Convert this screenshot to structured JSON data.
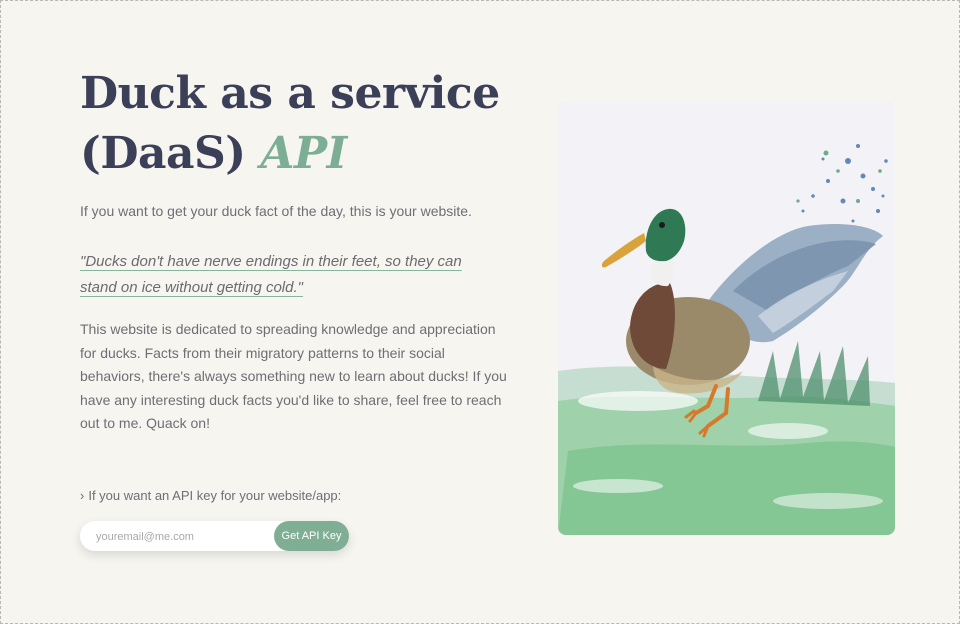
{
  "hero": {
    "title_line1": "Duck as a service",
    "title_line2": "(DaaS)",
    "title_accent": "API",
    "intro": "If you want to get your duck fact of the day, this is your website.",
    "quote": "\"Ducks don't have nerve endings in their feet, so they can stand on ice without getting cold.\"",
    "body": "This website is dedicated to spreading knowledge and appreciation for ducks. Facts from their migratory patterns to their social behaviors, there's always something new to learn about ducks! If you have any interesting duck facts you'd like to share, feel free to reach out to me. Quack on!"
  },
  "signup": {
    "label": "If you want an API key for your website/app:",
    "email_placeholder": "youremail@me.com",
    "button_label": "Get API Key"
  },
  "colors": {
    "background": "#f6f5f0",
    "title": "#3b3f58",
    "accent": "#7bae93",
    "button": "#7fae95"
  },
  "icons": {
    "cta": "chevron-right-icon"
  },
  "illustration": "watercolor-mallard-duck"
}
